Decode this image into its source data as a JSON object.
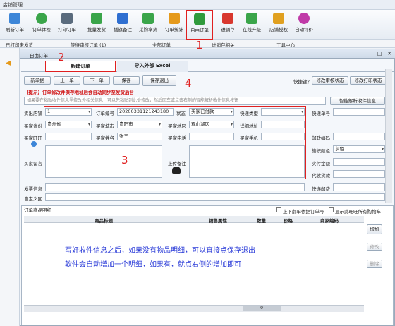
{
  "app": {
    "title": "店铺管理"
  },
  "toolbar": {
    "items": [
      {
        "label": "刷新订单",
        "icon": "refresh-icon",
        "color": "#3d86d8"
      },
      {
        "label": "订单体检",
        "icon": "add-icon",
        "color": "#3aa54a"
      },
      {
        "label": "打印订单",
        "icon": "printer-icon",
        "color": "#5a6b7d"
      },
      {
        "label": "批量发货",
        "icon": "thumb-icon",
        "color": "#3aa54a"
      },
      {
        "label": "插旗备注",
        "icon": "flag-icon",
        "color": "#2f6fd1"
      },
      {
        "label": "采购拿货",
        "icon": "cart-icon",
        "color": "#3aa54a"
      },
      {
        "label": "订单统计",
        "icon": "bar-chart-icon",
        "color": "#e59a1c"
      },
      {
        "label": "自由订单",
        "icon": "excel-icon",
        "color": "#2f9a3c"
      },
      {
        "label": "进销存",
        "icon": "cubes-icon",
        "color": "#d8372e"
      },
      {
        "label": "在线升级",
        "icon": "up-arrow-icon",
        "color": "#3aa54a"
      },
      {
        "label": "店铺授权",
        "icon": "lock-icon",
        "color": "#e0a020"
      },
      {
        "label": "自动评价",
        "icon": "chat-icon",
        "color": "#c03aa8"
      }
    ]
  },
  "groups": [
    "已打印未发货",
    "等待审核订单 (1)",
    "全部订单",
    "进销存相关",
    "工具中心"
  ],
  "dialog": {
    "title": "自由订单",
    "tab_new": "新建订单",
    "tab_import": "导入外部 Excel",
    "buttons": {
      "new": "新单据",
      "prev": "上一单",
      "next": "下一单",
      "save": "保存",
      "save_exit": "保存退出"
    },
    "quick_label": "快捷键？",
    "modify_status": "修改审核状态",
    "modify_print": "修改打印状态",
    "hint": "【提示】订单修改并保存地址后会自动同步至发货后台",
    "paste_placeholder": "如果要在粘贴收件信息里修改外相关信息，可以先粘贴到此处修改，然后回车或点击右侧的智能解析收件信息按钮",
    "smart_parse": "智能解析收件信息",
    "fields": {
      "shop_label": "卖出店铺",
      "shop_value": "1",
      "order_no_label": "订单编号",
      "order_no_value": "20200331121243180",
      "status_label": "状态",
      "status_value": "买家已付款",
      "express_label": "快递类型",
      "express_value": "",
      "express_no_label": "快递单号",
      "express_no_value": "",
      "province_label": "买家省份",
      "province_value": "贵州省",
      "city_label": "买家城市",
      "city_value": "贵阳市",
      "district_label": "买家地区",
      "district_value": "观山湖区",
      "address_label": "详细地址",
      "address_value": "",
      "wangwang_label": "买家旺旺",
      "wangwang_value": "",
      "name_label": "买家姓名",
      "name_value": "张三",
      "phone_label": "买家电话",
      "phone_value": "",
      "mobile_label": "买家手机",
      "mobile_value": "",
      "postcode_label": "邮政编码",
      "postcode_value": "",
      "flag_label": "旗帜颜色",
      "flag_value": "灰色",
      "actual_label": "实付金额",
      "actual_value": "",
      "cod_label": "代收货款",
      "cod_value": "",
      "message_label": "买家留言",
      "message_value": "",
      "upload_label": "上传备注",
      "invoice_label": "发票信息",
      "invoice_value": "",
      "custom_label": "自定义区",
      "custom_value": "",
      "express_fee_label": "快递邮费",
      "express_fee_value": ""
    },
    "sub_tab": "订单商品明细",
    "chk_up_down": "上下翻单依据订单号",
    "chk_show_all": "显示此旺旺所有购物车",
    "columns": [
      "商品标题",
      "销售属性",
      "数量",
      "价格",
      "商家编码"
    ],
    "side_buttons": {
      "add": "增加",
      "edit": "修改",
      "delete": "删除"
    },
    "note_line1": "写好收件信息之后，如果没有物品明细，可以直接点保存退出",
    "note_line2": "软件会自动增加一个明细，如果有，就点右侧的增加即可",
    "scroll_value": "0"
  },
  "annotations": {
    "n1": "1",
    "n2": "2",
    "n3": "3",
    "n4": "4"
  },
  "colors": {
    "highlight": "#e02020",
    "note": "#2a3bd8",
    "hint": "#d01010"
  }
}
